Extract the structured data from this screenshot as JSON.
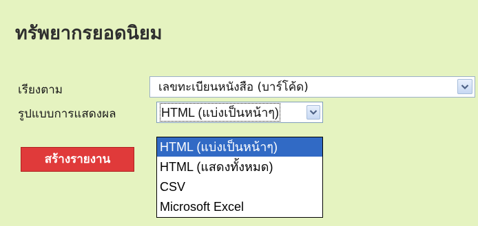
{
  "page": {
    "title": "ทรัพยากรยอดนิยม"
  },
  "form": {
    "sort_label": "เรียงตาม",
    "sort_value": "เลขทะเบียนหนังสือ (บาร์โค้ด)",
    "format_label": "รูปแบบการแสดงผล",
    "format_value": "HTML (แบ่งเป็นหน้าๆ)",
    "create_button": "สร้างรายงาน"
  },
  "format_options": [
    {
      "label": "HTML (แบ่งเป็นหน้าๆ)",
      "selected": true
    },
    {
      "label": "HTML (แสดงทั้งหมด)",
      "selected": false
    },
    {
      "label": "CSV",
      "selected": false
    },
    {
      "label": "Microsoft Excel",
      "selected": false
    }
  ],
  "icons": {
    "sort_dropdown": "chevron-down-icon",
    "format_dropdown": "chevron-down-icon"
  },
  "colors": {
    "background": "#e5f3c0",
    "button": "#e03a3a",
    "selection": "#316ac5"
  }
}
